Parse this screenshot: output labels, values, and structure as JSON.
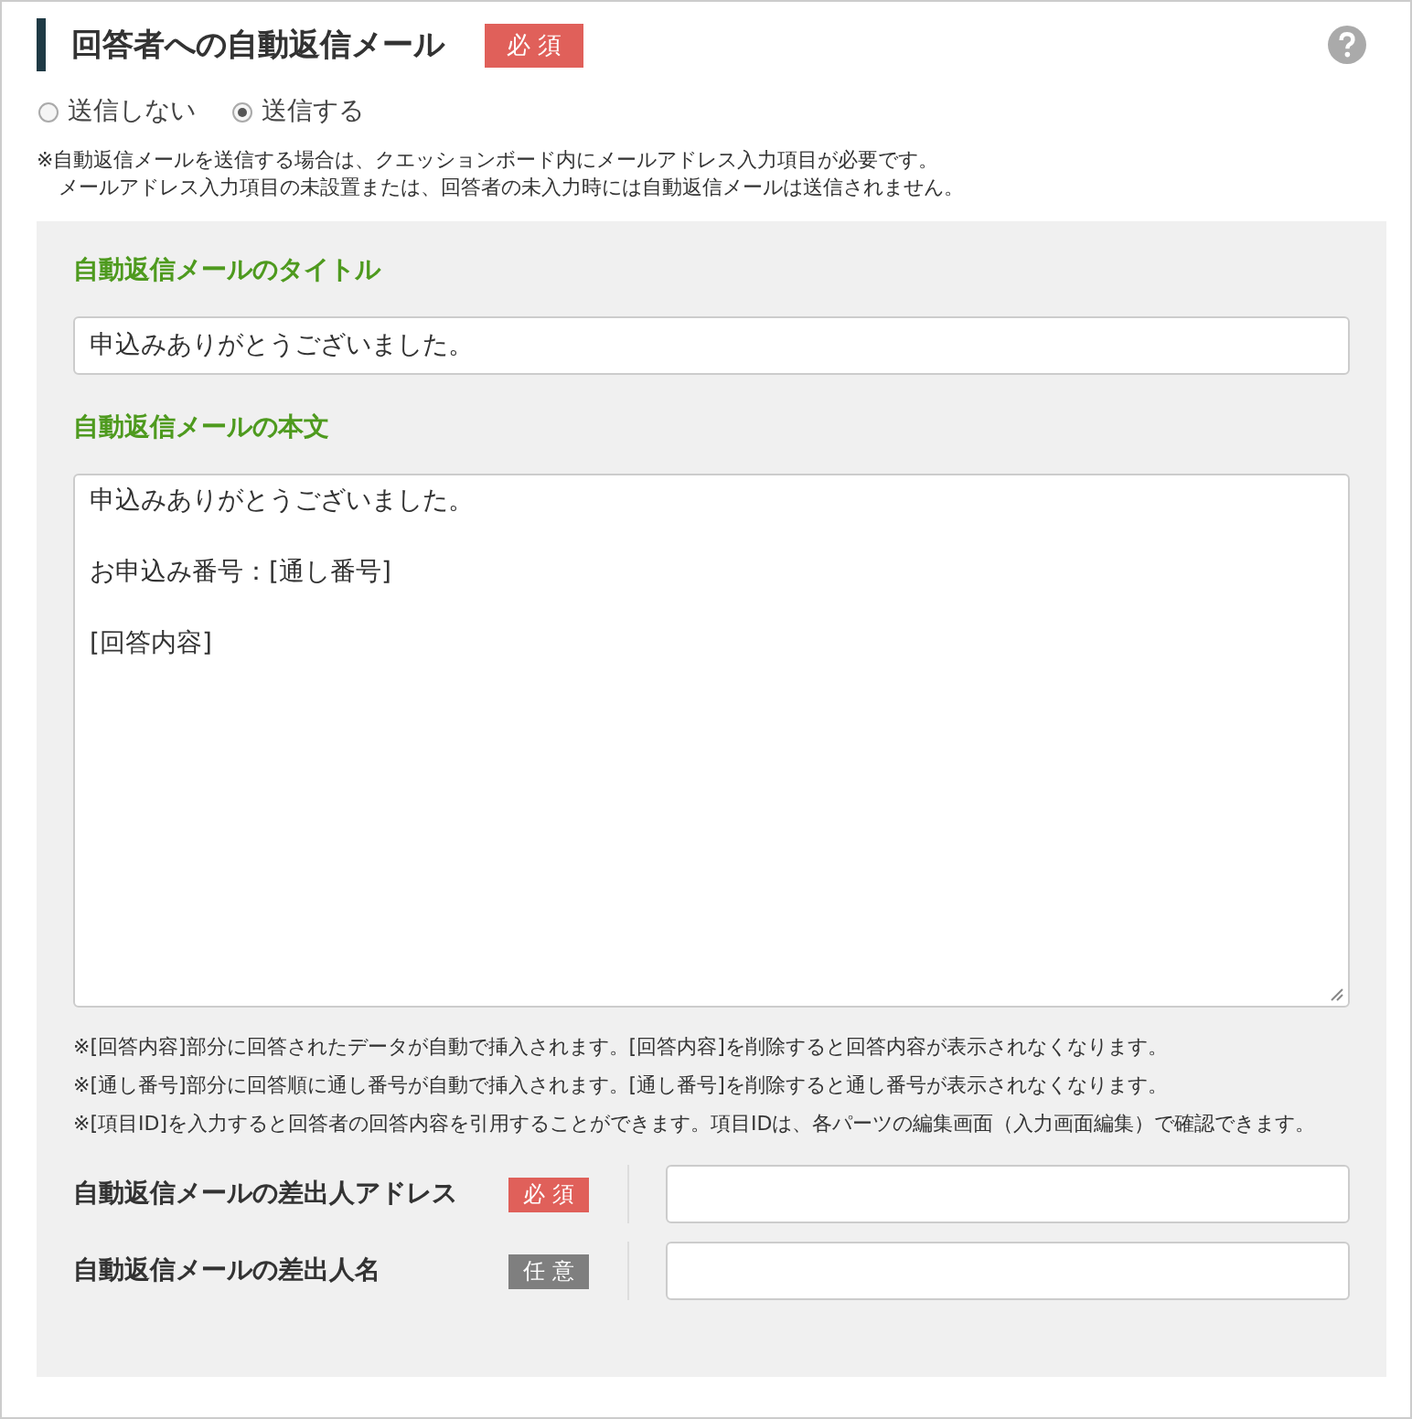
{
  "header": {
    "title": "回答者への自動返信メール",
    "badge": {
      "label": "必須",
      "kind": "required"
    }
  },
  "send_options": [
    {
      "label": "送信しない",
      "selected": false
    },
    {
      "label": "送信する",
      "selected": true
    }
  ],
  "notes": [
    "※自動返信メールを送信する場合は、クエッションボード内にメールアドレス入力項目が必要です。",
    "メールアドレス入力項目の未設置または、回答者の未入力時には自動返信メールは送信されません。"
  ],
  "mail_title": {
    "label": "自動返信メールのタイトル",
    "value": "申込みありがとうございました。"
  },
  "mail_body": {
    "label": "自動返信メールの本文",
    "paragraphs": [
      "申込みありがとうございました。",
      "お申込み番号：[通し番号]",
      "[回答内容]"
    ]
  },
  "body_notes": [
    "※[回答内容]部分に回答されたデータが自動で挿入されます。[回答内容]を削除すると回答内容が表示されなくなります。",
    "※[通し番号]部分に回答順に通し番号が自動で挿入されます。[通し番号]を削除すると通し番号が表示されなくなります。",
    "※[項目ID]を入力すると回答者の回答内容を引用することができます。項目IDは、各パーツの編集画面（入力画面編集）で確認できます。"
  ],
  "sender_fields": [
    {
      "label": "自動返信メールの差出人アドレス",
      "badge": {
        "label": "必須",
        "kind": "required"
      }
    },
    {
      "label": "自動返信メールの差出人名",
      "badge": {
        "label": "任意",
        "kind": "optional"
      }
    }
  ]
}
